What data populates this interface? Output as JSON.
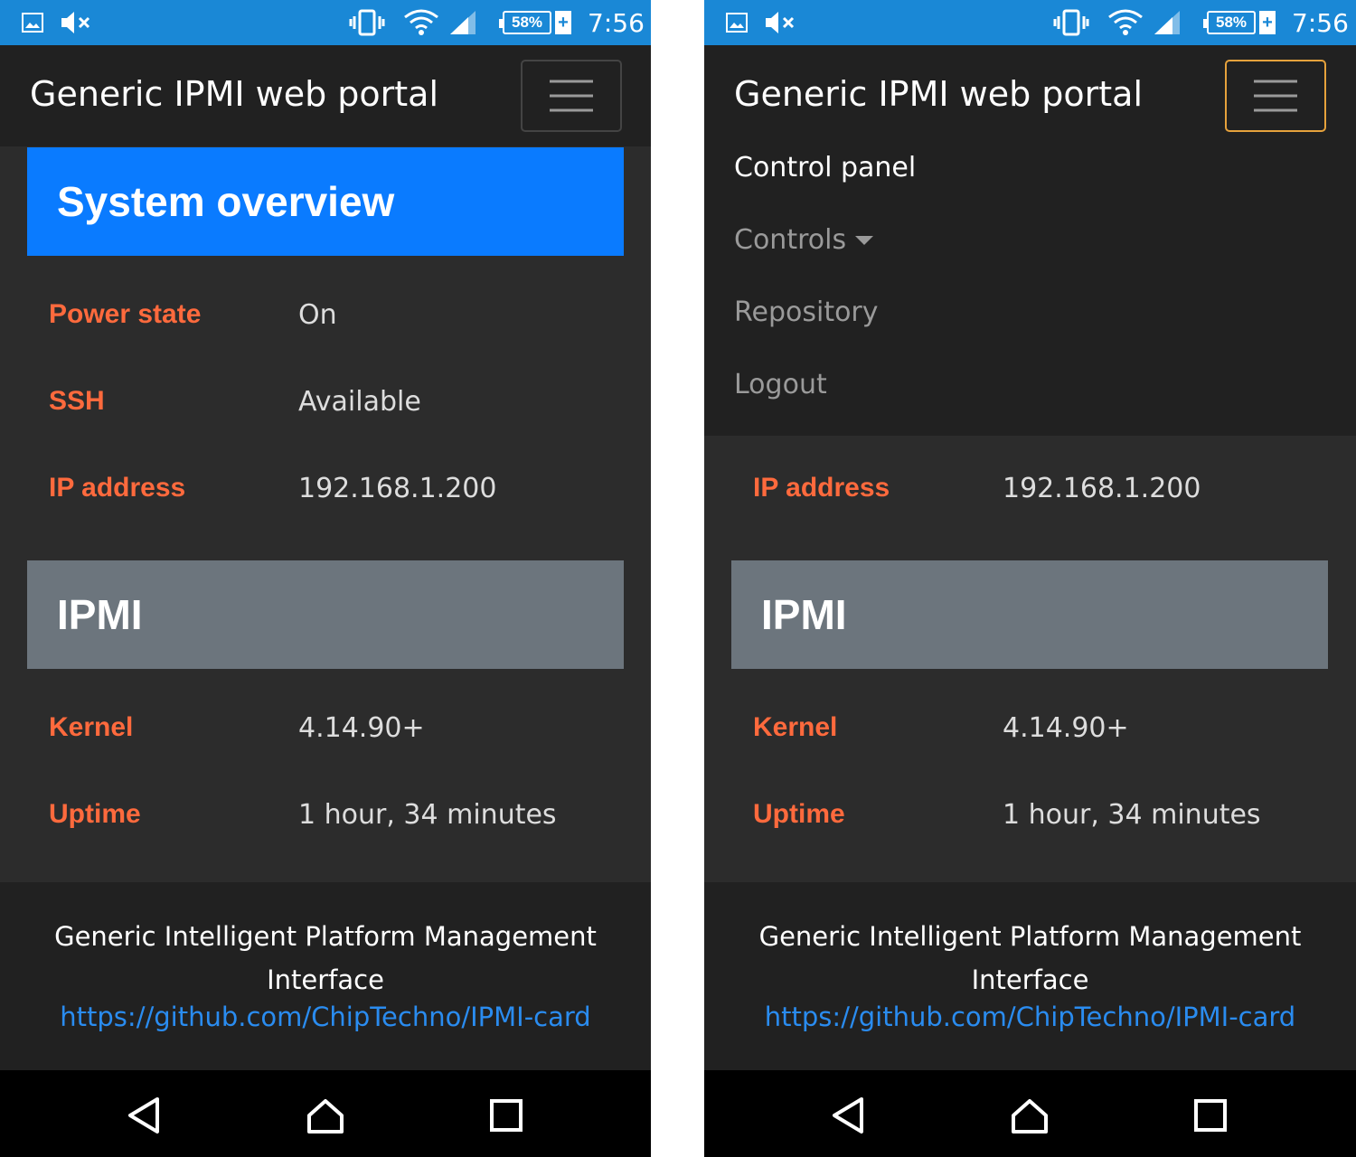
{
  "status_bar": {
    "battery": "58%",
    "battery_plus": "+",
    "time": "7:56"
  },
  "navbar": {
    "brand": "Generic IPMI web portal"
  },
  "menu": {
    "items": [
      {
        "label": "Control panel"
      },
      {
        "label": "Controls"
      },
      {
        "label": "Repository"
      },
      {
        "label": "Logout"
      }
    ]
  },
  "system_overview": {
    "title": "System overview",
    "rows": [
      {
        "label": "Power state",
        "value": "On"
      },
      {
        "label": "SSH",
        "value": "Available"
      },
      {
        "label": "IP address",
        "value": "192.168.1.200"
      }
    ]
  },
  "ipmi": {
    "title": "IPMI",
    "rows": [
      {
        "label": "Kernel",
        "value": "4.14.90+"
      },
      {
        "label": "Uptime",
        "value": "1 hour, 34 minutes"
      }
    ]
  },
  "footer": {
    "line1": "Generic Intelligent Platform Management",
    "line2": "Interface",
    "link": "https://github.com/ChipTechno/IPMI-card"
  },
  "colors": {
    "status_bar": "#1a88d6",
    "navbar": "#212121",
    "card_primary": "#0a7bff",
    "card_secondary": "#6c757d",
    "label_accent": "#ff6a3d",
    "link": "#2a8cf0",
    "toggler_focus": "#e6a23c"
  }
}
